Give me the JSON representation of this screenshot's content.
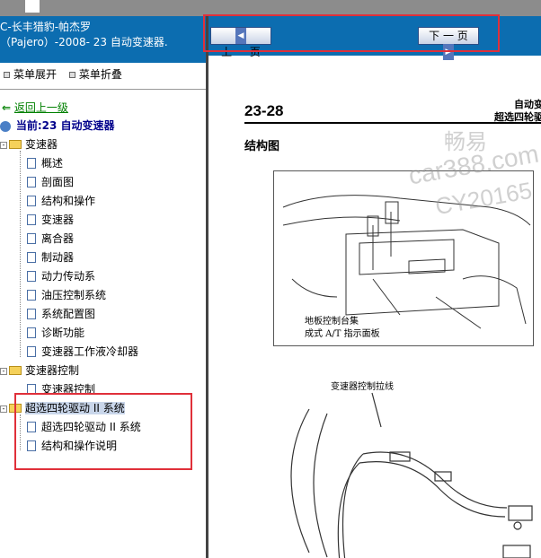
{
  "left_panel": {
    "title_line1": "C-长丰猎豹-帕杰罗",
    "title_line2": "（Pajero）-2008- 23 自动变速器.",
    "expand_label": "菜单展开",
    "collapse_label": "菜单折叠",
    "back_label": "返回上一级",
    "current_label": "当前:23 自动变速器",
    "tree": {
      "group1": "变速器",
      "group1_items": [
        "概述",
        "剖面图",
        "结构和操作",
        "变速器",
        "离合器",
        "制动器",
        "动力传动系",
        "油压控制系统",
        "系统配置图",
        "诊断功能",
        "变速器工作液冷却器"
      ],
      "group2": "变速器控制",
      "group2_items": [
        "变速器控制"
      ],
      "group3": "超选四轮驱动 II 系统",
      "group3_items": [
        "超选四轮驱动 II 系统",
        "结构和操作说明"
      ]
    }
  },
  "nav": {
    "prev_label": "上 一 页",
    "next_label": "下 一 页"
  },
  "doc": {
    "page_number": "23-28",
    "header_line1": "自动变",
    "header_line2": "超选四轮驱",
    "figure_title": "结构图",
    "fig1_label_line1": "地板控制台集",
    "fig1_label_line2": "成式 A/T 指示面板",
    "fig2_label": "变速器控制拉线"
  },
  "watermarks": [
    "畅易",
    "car388.com",
    "CY20165"
  ],
  "colors": {
    "title_bar": "#0c6db0",
    "highlight_box": "#e0303a",
    "link_green": "#008000",
    "current_blue": "#00008b"
  }
}
